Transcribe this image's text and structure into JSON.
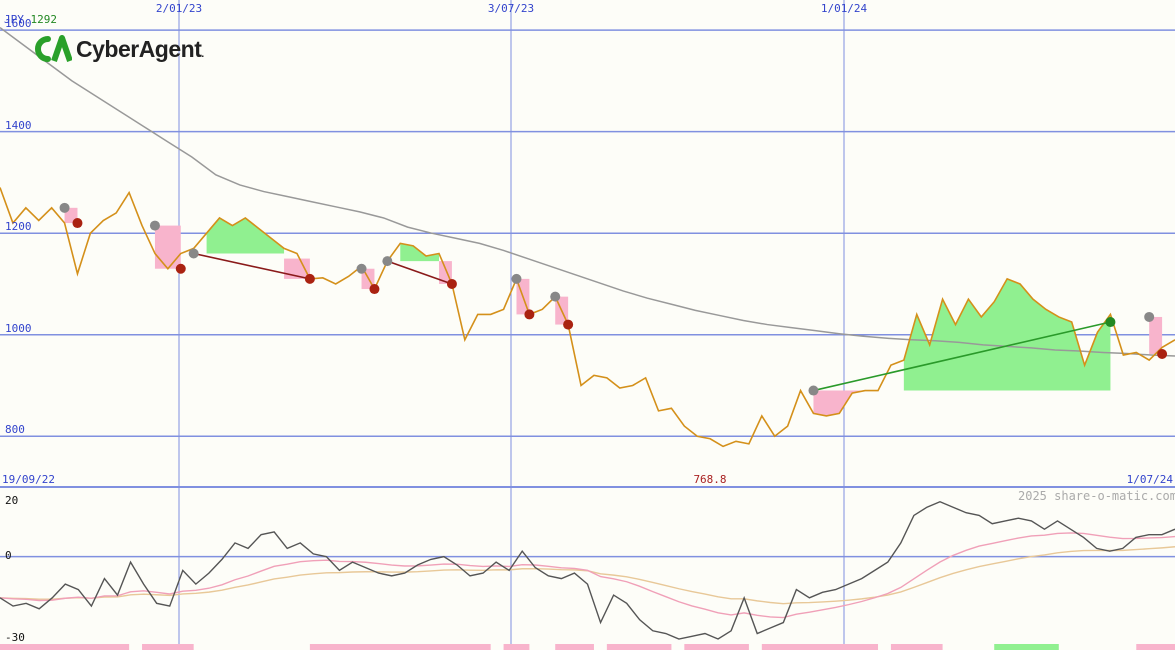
{
  "header": {
    "currency": "JPY",
    "last_price": "1292"
  },
  "logo": {
    "text": "CyberAgent",
    "mark": "CA",
    "suffix": "."
  },
  "watermark": "2025 share-o-matic.com",
  "colors": {
    "price": "#d4901a",
    "sma": "#999999",
    "grid": "#8090e0",
    "up_fill": "#90f090",
    "down_fill": "#f8b4cc",
    "high_marker": "#888888",
    "low_marker": "#aa2211",
    "buy_marker": "#228822",
    "osc_main": "#555555",
    "osc_fast": "#f0a0b8",
    "osc_slow": "#e8c898",
    "volume_down": "#f8b4cc",
    "volume_up": "#90f090",
    "logo_green": "#2aa02a"
  },
  "chart_data": {
    "type": "line",
    "y_axis": {
      "ticks": [
        800,
        1000,
        1200,
        1400,
        1600
      ],
      "range": [
        700,
        1620
      ]
    },
    "x_axis": {
      "start_label": "19/09/22",
      "end_label": "1/07/24",
      "top_labels": [
        "2/01/23",
        "3/07/23",
        "1/01/24"
      ]
    },
    "low_annotation": "768.8",
    "series": [
      {
        "role": "price",
        "values": [
          1290,
          1220,
          1250,
          1225,
          1250,
          1220,
          1120,
          1200,
          1225,
          1240,
          1280,
          1215,
          1160,
          1130,
          1160,
          1170,
          1200,
          1230,
          1215,
          1230,
          1210,
          1190,
          1170,
          1160,
          1110,
          1112,
          1100,
          1115,
          1135,
          1090,
          1145,
          1180,
          1175,
          1155,
          1160,
          1100,
          990,
          1040,
          1040,
          1050,
          1110,
          1040,
          1050,
          1075,
          1020,
          900,
          920,
          915,
          895,
          900,
          915,
          850,
          855,
          820,
          800,
          795,
          780,
          790,
          785,
          840,
          800,
          820,
          890,
          845,
          840,
          845,
          885,
          890,
          890,
          940,
          950,
          1040,
          980,
          1070,
          1020,
          1070,
          1035,
          1065,
          1110,
          1100,
          1070,
          1050,
          1035,
          1025,
          940,
          1005,
          1040,
          960,
          965,
          950,
          975,
          990
        ]
      },
      {
        "role": "sma",
        "values": [
          1605,
          1570,
          1535,
          1500,
          1470,
          1440,
          1410,
          1380,
          1350,
          1315,
          1295,
          1282,
          1272,
          1262,
          1252,
          1242,
          1230,
          1212,
          1200,
          1190,
          1180,
          1166,
          1150,
          1134,
          1118,
          1102,
          1086,
          1072,
          1060,
          1048,
          1038,
          1028,
          1020,
          1014,
          1008,
          1002,
          997,
          993,
          990,
          988,
          985,
          980,
          977,
          974,
          970,
          968,
          965,
          963,
          960,
          958
        ]
      }
    ],
    "highs": [
      {
        "x": 5,
        "y": 1250
      },
      {
        "x": 12,
        "y": 1215
      },
      {
        "x": 15,
        "y": 1160
      },
      {
        "x": 28,
        "y": 1130
      },
      {
        "x": 30,
        "y": 1145
      },
      {
        "x": 40,
        "y": 1110
      },
      {
        "x": 43,
        "y": 1075
      },
      {
        "x": 63,
        "y": 890
      },
      {
        "x": 89,
        "y": 1035
      }
    ],
    "lows": [
      {
        "x": 6,
        "y": 1220
      },
      {
        "x": 14,
        "y": 1130
      },
      {
        "x": 24,
        "y": 1110
      },
      {
        "x": 29,
        "y": 1090
      },
      {
        "x": 35,
        "y": 1100
      },
      {
        "x": 41,
        "y": 1040
      },
      {
        "x": 44,
        "y": 1020
      },
      {
        "x": 90,
        "y": 962
      }
    ],
    "buy_signals": [
      {
        "x": 86,
        "y": 1025
      }
    ],
    "trend_lines": [
      {
        "from": {
          "x": 15,
          "y": 1160
        },
        "to": {
          "x": 24,
          "y": 1110
        },
        "kind": "down"
      },
      {
        "from": {
          "x": 30,
          "y": 1145
        },
        "to": {
          "x": 35,
          "y": 1100
        },
        "kind": "down"
      },
      {
        "from": {
          "x": 63,
          "y": 890
        },
        "to": {
          "x": 86,
          "y": 1025
        },
        "kind": "up"
      }
    ],
    "oscillator": {
      "y_ticks": [
        20,
        0,
        -30
      ],
      "main": [
        -15,
        -18,
        -17,
        -19,
        -15,
        -10,
        -12,
        -18,
        -8,
        -14,
        -2,
        -10,
        -17,
        -18,
        -5,
        -10,
        -6,
        -1,
        5,
        3,
        8,
        9,
        3,
        5,
        1,
        0,
        -5,
        -2,
        -4,
        -6,
        -7,
        -6,
        -3,
        -1,
        0,
        -3,
        -7,
        -6,
        -2,
        -5,
        2,
        -4,
        -7,
        -8,
        -6,
        -10,
        -24,
        -14,
        -17,
        -23,
        -27,
        -28,
        -30,
        -29,
        -28,
        -30,
        -27,
        -15,
        -28,
        -26,
        -24,
        -12,
        -15,
        -13,
        -12,
        -10,
        -8,
        -5,
        -2,
        5,
        15,
        18,
        20,
        18,
        16,
        15,
        12,
        13,
        14,
        13,
        10,
        13,
        10,
        7,
        3,
        2,
        3,
        7,
        8,
        8,
        10
      ]
    },
    "volume": {
      "down_segments": [
        [
          0,
          10
        ],
        [
          11,
          15
        ],
        [
          24,
          38
        ],
        [
          39,
          41
        ],
        [
          43,
          46
        ],
        [
          47,
          52
        ],
        [
          53,
          58
        ],
        [
          59,
          68
        ],
        [
          69,
          73
        ],
        [
          88,
          91
        ]
      ],
      "up_segments": [
        [
          77,
          82
        ]
      ]
    }
  }
}
